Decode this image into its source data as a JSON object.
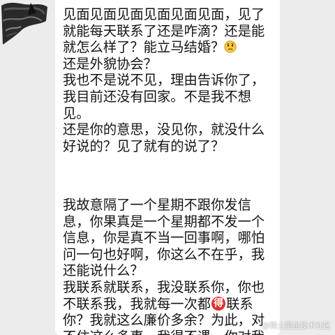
{
  "avatar": {
    "icon": "scribble-avatar-icon"
  },
  "message": {
    "paragraph1_part1": "见面见面见面见面见面见面，见了就能每天联系了还是咋滴？还是能就怎么样了？能立马结婚？",
    "paragraph1_emoji": "frowning-face-emoji",
    "paragraph1_part2": "\n还是外貌协会？\n我也不是说不见，理由告诉你了，我目前还没有回家。不是我不想见。\n还是你的意思，没见你，就没什么好说的？见了就有的说了？",
    "paragraph2_part1": "我故意隔了一个星期不跟你发信息，你果真是一个星期都不发一个信息，你是真不当一回事啊，哪怕问一句也好啊，你这么不在乎，我还能说什么？\n我联系就联系，我没联系你，你也不联系我，我就每一次都",
    "badge_char": "得",
    "paragraph2_part2": "联系你？我就这么廉价多余？为此，对不住这么多事，我得不遇，你对我"
  },
  "watermark": "@稀土掘金技术社区",
  "colors": {
    "background": "#ececec",
    "bubble": "#ffffff",
    "text": "#141414",
    "badge": "#e0302a",
    "emoji": "#f5c842"
  }
}
